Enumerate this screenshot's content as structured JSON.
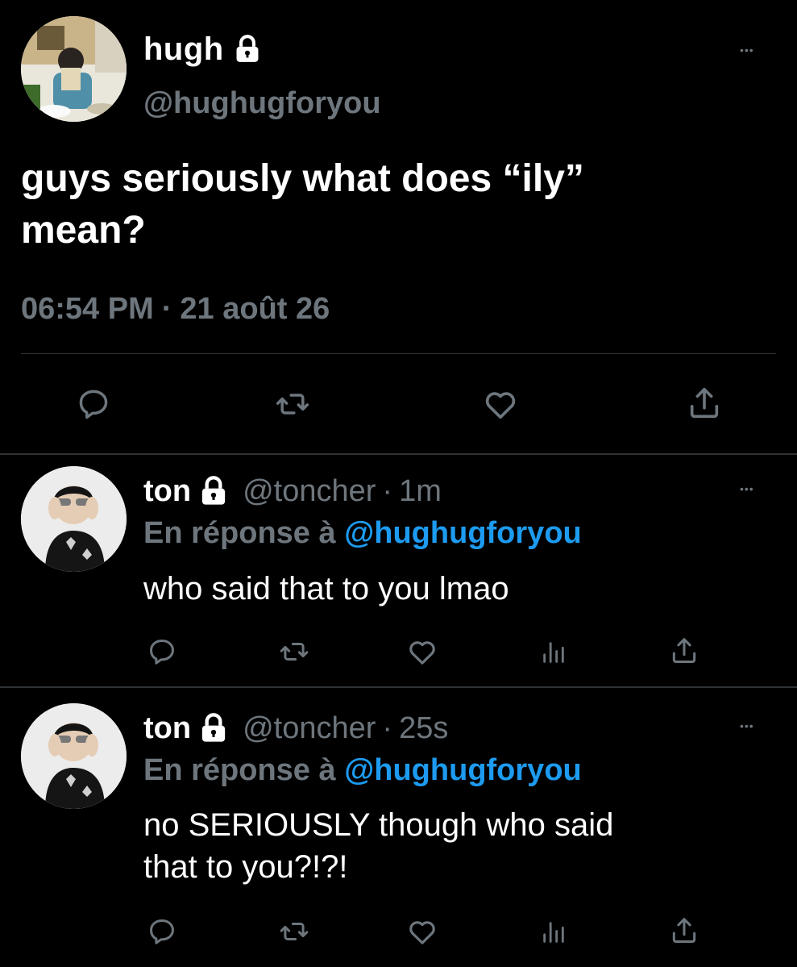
{
  "main_tweet": {
    "display_name": "hugh",
    "handle": "@hughugforyou",
    "text_line1": "guys seriously what does “ily”",
    "text_line2": "mean?",
    "time": "06:54 PM",
    "separator": "·",
    "date": "21 août 26",
    "more": "•••",
    "icons": [
      "reply-icon",
      "retweet-icon",
      "like-icon",
      "share-icon"
    ]
  },
  "replies": [
    {
      "display_name": "ton",
      "handle": "@toncher",
      "time_sep": "·",
      "time": "1m",
      "reply_prefix": "En réponse à",
      "reply_to": "@hughugforyou",
      "text_line1": "who said that to you lmao",
      "text_line2": "",
      "more": "•••"
    },
    {
      "display_name": "ton",
      "handle": "@toncher",
      "time_sep": "·",
      "time": "25s",
      "reply_prefix": "En réponse à",
      "reply_to": "@hughugforyou",
      "text_line1": "no SERIOUSLY though who said",
      "text_line2": "that to you?!?!",
      "more": "•••"
    }
  ],
  "colors": {
    "background": "#000000",
    "text": "#ffffff",
    "secondary": "#6e767d",
    "accent": "#1d9bf0",
    "divider": "#2f3336"
  }
}
